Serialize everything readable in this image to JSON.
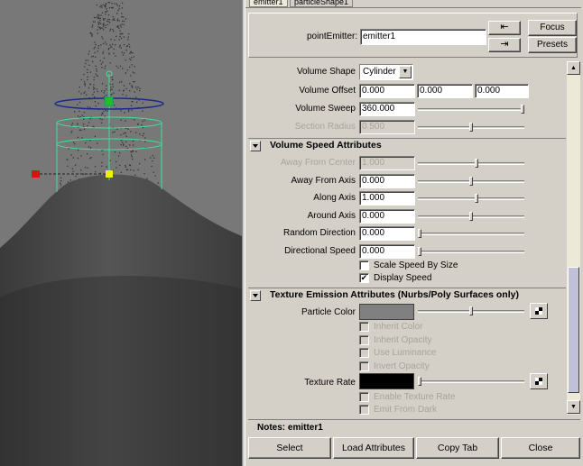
{
  "tabs": [
    "emitter1",
    "particleShape1"
  ],
  "header": {
    "node_type_label": "pointEmitter:",
    "node_name": "emitter1",
    "focus_label": "Focus",
    "presets_label": "Presets"
  },
  "volume": {
    "shape_label": "Volume Shape",
    "shape_value": "Cylinder",
    "offset_label": "Volume Offset",
    "offset_values": [
      "0.000",
      "0.000",
      "0.000"
    ],
    "sweep_label": "Volume Sweep",
    "sweep_value": "360.000",
    "sweep_level": 1.0,
    "section_radius_label": "Section Radius",
    "section_radius_value": "0.500",
    "section_radius_level": 0.5
  },
  "volume_speed": {
    "title": "Volume Speed Attributes",
    "rows": [
      {
        "label": "Away From Center",
        "value": "1.000",
        "level": 0.55,
        "disabled": true
      },
      {
        "label": "Away From Axis",
        "value": "0.000",
        "level": 0.5,
        "disabled": false
      },
      {
        "label": "Along Axis",
        "value": "1.000",
        "level": 0.55,
        "disabled": false
      },
      {
        "label": "Around Axis",
        "value": "0.000",
        "level": 0.5,
        "disabled": false
      },
      {
        "label": "Random Direction",
        "value": "0.000",
        "level": 0.0,
        "disabled": false
      },
      {
        "label": "Directional Speed",
        "value": "0.000",
        "level": 0.0,
        "disabled": false
      }
    ],
    "scale_speed_label": "Scale Speed By Size",
    "scale_speed_checked": false,
    "display_speed_label": "Display Speed",
    "display_speed_checked": true
  },
  "texture": {
    "title": "Texture Emission Attributes (Nurbs/Poly Surfaces only)",
    "particle_color_label": "Particle Color",
    "particle_color": "#808080",
    "particle_color_level": 0.5,
    "inherit_color_label": "Inherit Color",
    "inherit_opacity_label": "Inherit Opacity",
    "use_luminance_label": "Use Luminance",
    "invert_opacity_label": "Invert Opacity",
    "texture_rate_label": "Texture Rate",
    "texture_rate_color": "#000000",
    "texture_rate_level": 0.0,
    "enable_texture_rate_label": "Enable Texture Rate",
    "emit_from_dark_label": "Emit From Dark"
  },
  "notes_label": "Notes:  emitter1",
  "buttons": {
    "select": "Select",
    "load_attributes": "Load Attributes",
    "copy_tab": "Copy Tab",
    "close": "Close"
  },
  "colors": {
    "panel_bg": "#d4d0c8",
    "viewport_bg": "#777777",
    "manipulator_green": "#40e0a0",
    "ring_blue": "#1a2a90"
  },
  "icons": [
    "select-node-icon",
    "load-node-icon",
    "texture-map-icon",
    "chevron-down-icon",
    "scroll-up-icon",
    "scroll-down-icon",
    "checkmark-icon"
  ]
}
